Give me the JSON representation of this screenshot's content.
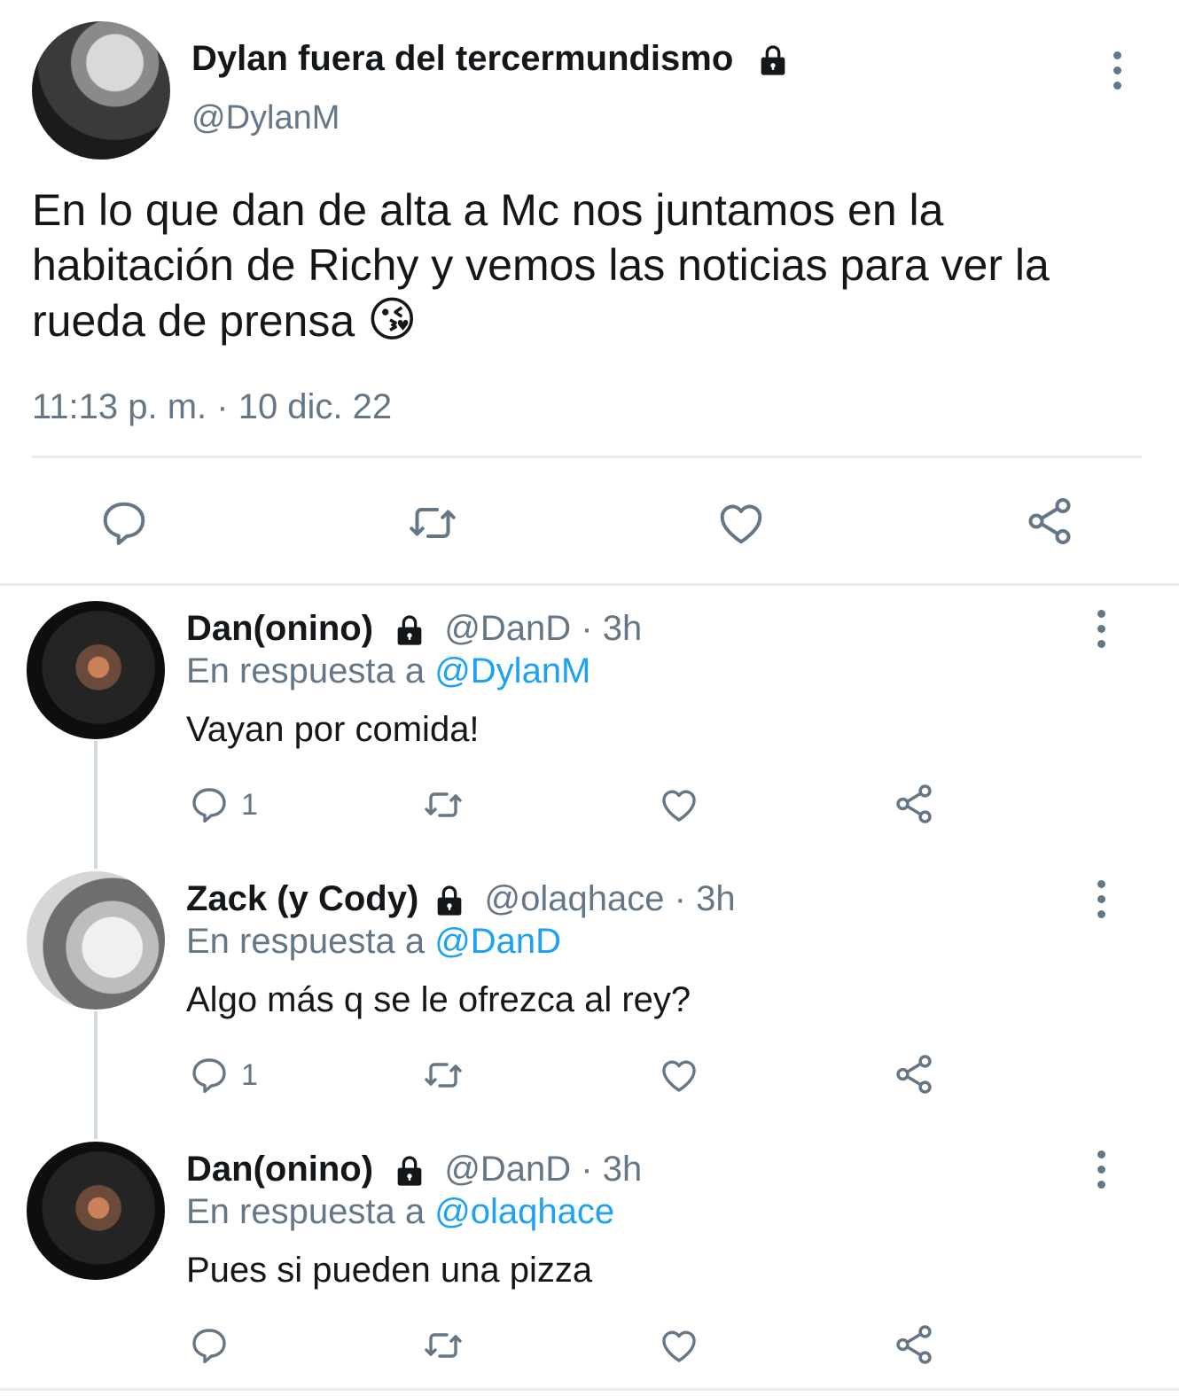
{
  "main_tweet": {
    "display_name": "Dylan fuera del tercermundismo",
    "handle": "@DylanM",
    "text": "En lo que dan de alta a Mc nos juntamos en la habitación de Richy y vemos las noticias para ver la rueda de prensa",
    "emoji": "😘",
    "timestamp": "11:13 p. m. · 10 dic. 22",
    "actions": [
      "reply-icon",
      "retweet-icon",
      "like-icon",
      "share-icon"
    ]
  },
  "replies": [
    {
      "display_name": "Dan(onino)",
      "handle": "@DanD",
      "time": "· 3h",
      "reply_prefix": "En respuesta a",
      "reply_to": "@DylanM",
      "text": "Vayan por comida!",
      "reply_count": "1"
    },
    {
      "display_name": "Zack (y Cody)",
      "handle": "@olaqhace",
      "time": "· 3h",
      "reply_prefix": "En respuesta a",
      "reply_to": "@DanD",
      "text": "Algo más q se le ofrezca al rey?",
      "reply_count": "1"
    },
    {
      "display_name": "Dan(onino)",
      "handle": "@DanD",
      "time": "· 3h",
      "reply_prefix": "En respuesta a",
      "reply_to": "@olaqhace",
      "text": "Pues si pueden una pizza",
      "reply_count": ""
    }
  ],
  "colors": {
    "text": "#14171a",
    "muted": "#657786",
    "link": "#1da1f2",
    "divider": "#e6ecf0"
  }
}
